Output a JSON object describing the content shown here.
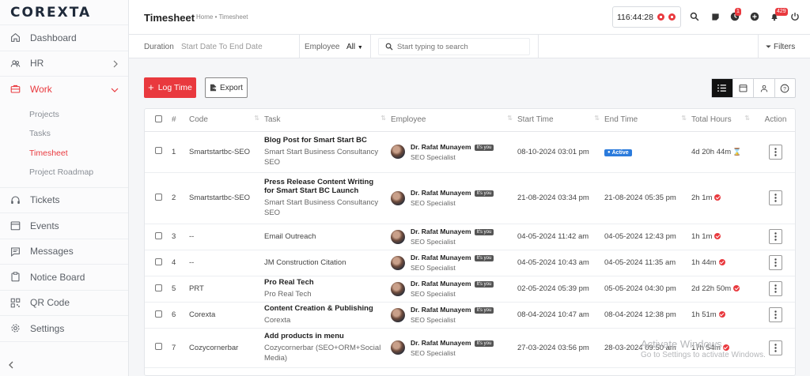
{
  "brand": {
    "logo_text": "COREXTA"
  },
  "sidebar": {
    "items": [
      {
        "label": "Dashboard"
      },
      {
        "label": "HR"
      },
      {
        "label": "Work"
      },
      {
        "label": "Tickets"
      },
      {
        "label": "Events"
      },
      {
        "label": "Messages"
      },
      {
        "label": "Notice Board"
      },
      {
        "label": "QR Code"
      },
      {
        "label": "Settings"
      }
    ],
    "work_sub": [
      {
        "label": "Projects"
      },
      {
        "label": "Tasks"
      },
      {
        "label": "Timesheet"
      },
      {
        "label": "Project Roadmap"
      }
    ]
  },
  "header": {
    "title": "Timesheet",
    "breadcrumb": "Home • Timesheet",
    "timer": "116:44:28",
    "notification_badge_1": "1",
    "notification_badge_2": "429"
  },
  "filters": {
    "duration_label": "Duration",
    "duration_value": "Start Date To End Date",
    "employee_label": "Employee",
    "employee_value": "All",
    "search_placeholder": "Start typing to search",
    "filters_label": "Filters"
  },
  "actions": {
    "log_time": "Log Time",
    "export": "Export"
  },
  "table": {
    "columns": [
      "#",
      "Code",
      "Task",
      "Employee",
      "Start Time",
      "End Time",
      "Total Hours",
      "Action"
    ],
    "rows": [
      {
        "num": "1",
        "code": "Smartstartbc-SEO",
        "task": "Blog Post for Smart Start BC",
        "project": "Smart Start Business Consultancy SEO",
        "employee": "Dr. Rafat Munayem",
        "tag": "It's you",
        "role": "SEO Specialist",
        "start": "08-10-2024 03:01 pm",
        "end": "",
        "end_badge": "Active",
        "hours": "4d 20h 44m"
      },
      {
        "num": "2",
        "code": "Smartstartbc-SEO",
        "task": "Press Release Content Writing for Smart Start BC Launch",
        "project": "Smart Start Business Consultancy SEO",
        "employee": "Dr. Rafat Munayem",
        "tag": "It's you",
        "role": "SEO Specialist",
        "start": "21-08-2024 03:34 pm",
        "end": "21-08-2024 05:35 pm",
        "end_badge": "",
        "hours": "2h 1m"
      },
      {
        "num": "3",
        "code": "--",
        "task": "",
        "project": "Email Outreach",
        "employee": "Dr. Rafat Munayem",
        "tag": "It's you",
        "role": "SEO Specialist",
        "start": "04-05-2024 11:42 am",
        "end": "04-05-2024 12:43 pm",
        "end_badge": "",
        "hours": "1h 1m"
      },
      {
        "num": "4",
        "code": "--",
        "task": "",
        "project": "JM Construction Citation",
        "employee": "Dr. Rafat Munayem",
        "tag": "It's you",
        "role": "SEO Specialist",
        "start": "04-05-2024 10:43 am",
        "end": "04-05-2024 11:35 am",
        "end_badge": "",
        "hours": "1h 44m"
      },
      {
        "num": "5",
        "code": "PRT",
        "task": "Pro Real Tech",
        "project": "Pro Real Tech",
        "employee": "Dr. Rafat Munayem",
        "tag": "It's you",
        "role": "SEO Specialist",
        "start": "02-05-2024 05:39 pm",
        "end": "05-05-2024 04:30 pm",
        "end_badge": "",
        "hours": "2d 22h 50m"
      },
      {
        "num": "6",
        "code": "Corexta",
        "task": "Content Creation & Publishing",
        "project": "Corexta",
        "employee": "Dr. Rafat Munayem",
        "tag": "It's you",
        "role": "SEO Specialist",
        "start": "08-04-2024 10:47 am",
        "end": "08-04-2024 12:38 pm",
        "end_badge": "",
        "hours": "1h 51m"
      },
      {
        "num": "7",
        "code": "Cozycornerbar",
        "task": "Add products in menu",
        "project": "Cozycornerbar (SEO+ORM+Social Media)",
        "employee": "Dr. Rafat Munayem",
        "tag": "It's you",
        "role": "SEO Specialist",
        "start": "27-03-2024 03:56 pm",
        "end": "28-03-2024 09:50 am",
        "end_badge": "",
        "hours": "17h 54m"
      }
    ]
  },
  "watermark": {
    "line1": "Activate Windows",
    "line2": "Go to Settings to activate Windows."
  },
  "colors": {
    "accent": "#e9393e",
    "brand": "#2b7bdc"
  }
}
